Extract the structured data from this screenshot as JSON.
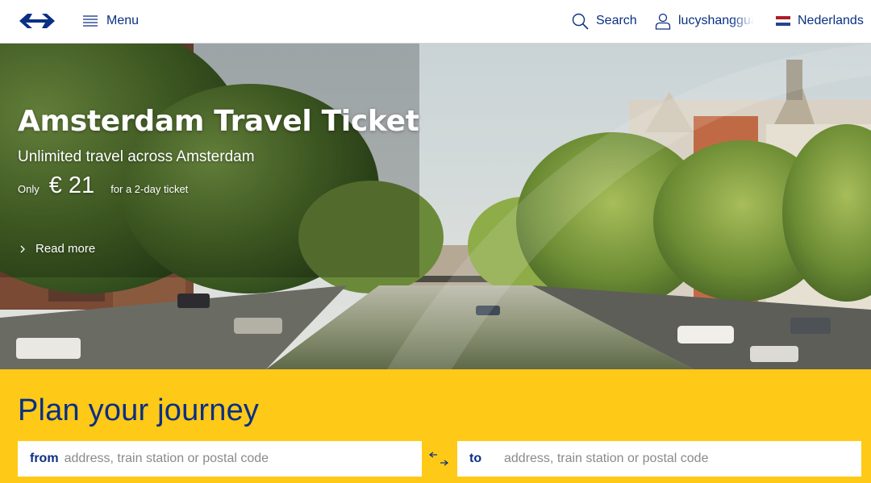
{
  "header": {
    "logo_icon": "ns-logo-icon",
    "menu_label": "Menu",
    "search_label": "Search",
    "user_label": "lucyshangguan",
    "language_label": "Nederlands"
  },
  "hero": {
    "title": "Amsterdam Travel Ticket",
    "subtitle": "Unlimited travel across Amsterdam",
    "price_prefix": "Only",
    "price": "€ 21",
    "price_note": "for a 2-day ticket",
    "read_more": "Read more"
  },
  "planner": {
    "title": "Plan your journey",
    "from_label": "from",
    "from_placeholder": "address, train station or postal code",
    "to_label": "to",
    "to_placeholder": "address, train station or postal code"
  },
  "colors": {
    "brand_blue": "#0a2f84",
    "brand_yellow": "#ffc917",
    "flag_red": "#ae1c28",
    "flag_white": "#ffffff",
    "flag_blue": "#21468b"
  }
}
